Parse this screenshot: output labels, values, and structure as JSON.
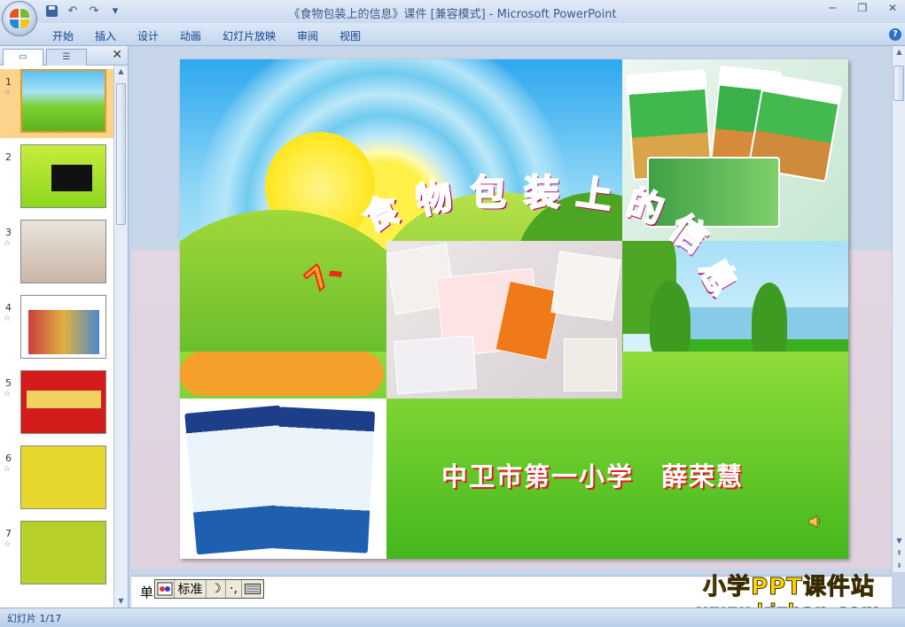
{
  "window": {
    "title": "《食物包装上的信息》课件 [兼容模式] - Microsoft PowerPoint"
  },
  "quick_access": {
    "icons": [
      "save-icon",
      "undo-icon",
      "redo-icon",
      "customize-icon"
    ]
  },
  "menu": {
    "items": [
      "开始",
      "插入",
      "设计",
      "动画",
      "幻灯片放映",
      "审阅",
      "视图"
    ]
  },
  "panel": {
    "close_glyph": "✕",
    "slides": [
      {
        "number": "1",
        "star": "☆"
      },
      {
        "number": "2",
        "star": ""
      },
      {
        "number": "3",
        "star": "☆"
      },
      {
        "number": "4",
        "star": "☆"
      },
      {
        "number": "5",
        "star": "☆"
      },
      {
        "number": "6",
        "star": "☆"
      },
      {
        "number": "7",
        "star": "☆"
      }
    ]
  },
  "slide": {
    "number_prefix": "7、",
    "title_chars": [
      "食",
      "物",
      "包",
      "装",
      "上",
      "的",
      "信",
      "息"
    ],
    "subtitle": "中卫市第一小学　薛荣慧"
  },
  "notes": {
    "text": "单"
  },
  "ime": {
    "mode_label": "标准",
    "punct": "·,"
  },
  "brand": {
    "line1": "小学PPT课件站",
    "line2": "www.kjzhan.com"
  },
  "status": {
    "slide_indicator": "幻灯片 1/17"
  },
  "colors": {
    "title_pink": "#ff3fa6",
    "subtitle_red": "#e31c1c",
    "brand_yellow": "#ffd400"
  }
}
